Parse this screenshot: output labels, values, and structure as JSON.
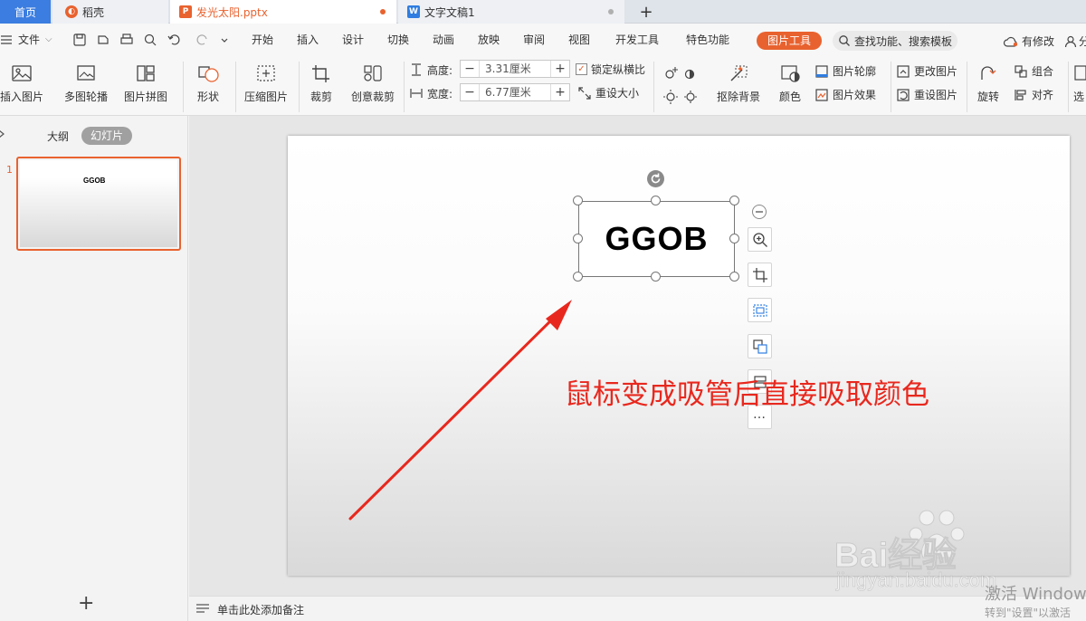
{
  "tabs": {
    "home": "首页",
    "daoke": "稻壳",
    "pptx": "发光太阳.pptx",
    "doc": "文字文稿1",
    "add": "+"
  },
  "menu": {
    "file": "文件",
    "items": [
      "开始",
      "插入",
      "设计",
      "切换",
      "动画",
      "放映",
      "审阅",
      "视图",
      "开发工具",
      "特色功能"
    ],
    "picture_tools": "图片工具",
    "search": "查找功能、搜索模板",
    "modified": "有修改",
    "share": "分"
  },
  "ribbon": {
    "insert_picture": "插入图片",
    "multi_outline": "多图轮播",
    "picture_collage": "图片拼图",
    "shape": "形状",
    "compress": "压缩图片",
    "crop": "裁剪",
    "creative_crop": "创意裁剪",
    "height_label": "高度:",
    "height_value": "3.31厘米",
    "width_label": "宽度:",
    "width_value": "6.77厘米",
    "lock_ratio": "锁定纵横比",
    "reset_size": "重设大小",
    "remove_bg": "抠除背景",
    "color": "颜色",
    "outline": "图片轮廓",
    "effect": "图片效果",
    "change_picture": "更改图片",
    "reset_picture": "重设图片",
    "rotate": "旋转",
    "group": "组合",
    "align": "对齐",
    "select": "选"
  },
  "panel": {
    "outline_tab": "大纲",
    "slides_tab": "幻灯片",
    "slide_number": "1",
    "thumb_text": "GGOB"
  },
  "slide": {
    "picture_text": "GGOB",
    "annotation": "鼠标变成吸管后直接吸取颜色"
  },
  "notes": {
    "placeholder": "单击此处添加备注"
  },
  "watermark": {
    "baidu": "Bai经验",
    "url": "jingyan.baidu.com",
    "activate": "激活 Windows",
    "goto": "转到\"设置\"以激活"
  },
  "colors": {
    "accent": "#e8622f",
    "word_blue": "#2f7de1",
    "annotation_red": "#e8281e",
    "tab_active": "#3b7de0"
  }
}
